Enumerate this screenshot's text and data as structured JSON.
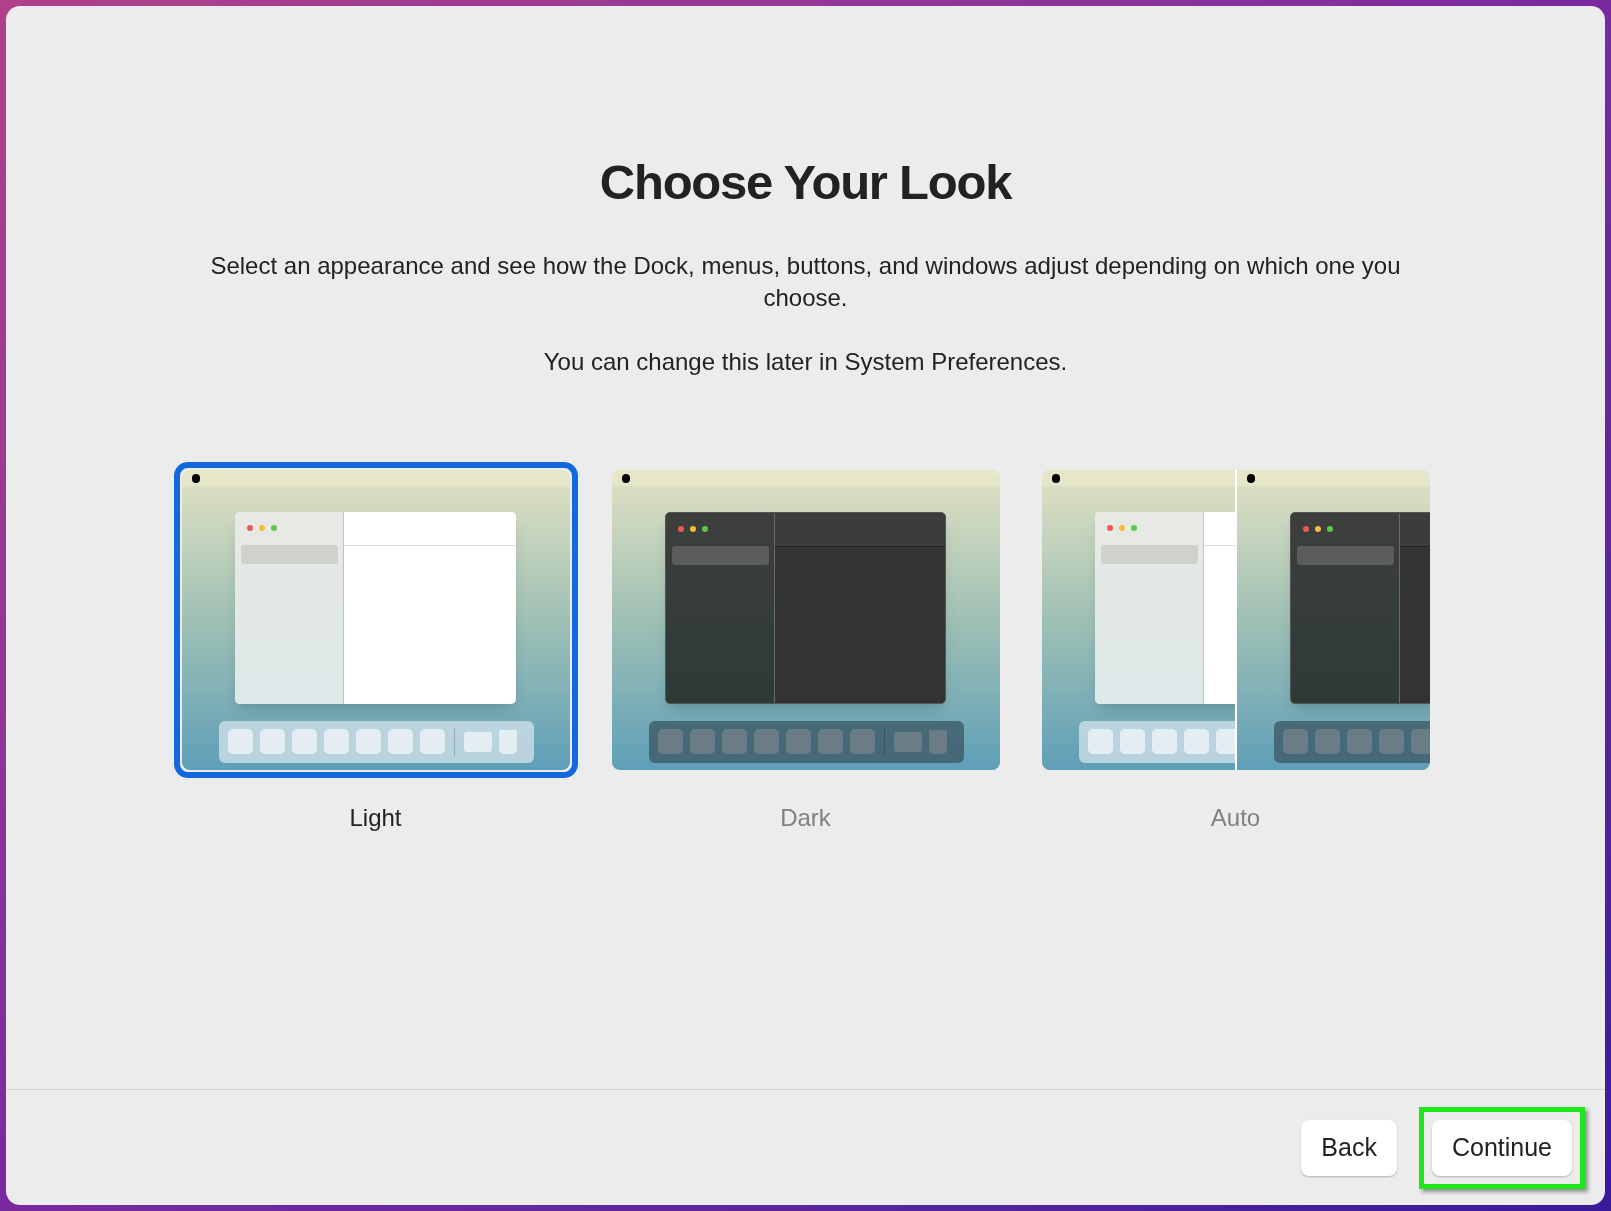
{
  "title": "Choose Your Look",
  "description": "Select an appearance and see how the Dock, menus, buttons, and windows adjust depending on which one you choose.",
  "note": "You can change this later in System Preferences.",
  "appearances": [
    {
      "label": "Light",
      "kind": "light",
      "selected": true
    },
    {
      "label": "Dark",
      "kind": "dark",
      "selected": false
    },
    {
      "label": "Auto",
      "kind": "auto",
      "selected": false
    }
  ],
  "buttons": [
    {
      "label": "Back",
      "highlighted": false
    },
    {
      "label": "Continue",
      "highlighted": true
    }
  ]
}
